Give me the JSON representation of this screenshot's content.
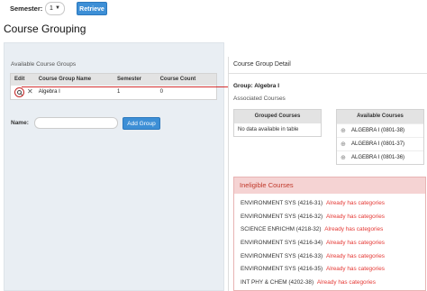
{
  "topbar": {
    "semester_label": "Semester:",
    "semester_value": "1",
    "retrieve_label": "Retrieve"
  },
  "page_title": "Course Grouping",
  "left": {
    "panel_title": "Available Course Groups",
    "columns": [
      "Edit",
      "Course Group Name",
      "Semester",
      "Course Count"
    ],
    "rows": [
      {
        "name": "Algebra I",
        "semester": "1",
        "count": "0"
      }
    ],
    "name_label": "Name:",
    "name_value": "",
    "add_group_label": "Add Group"
  },
  "detail": {
    "panel_title": "Course Group Detail",
    "group_label": "Group: Algebra I",
    "associated_label": "Associated Courses",
    "grouped_header": "Grouped Courses",
    "grouped_empty": "No data available in table",
    "available_header": "Available Courses",
    "available": [
      "ALGEBRA I (0801-38)",
      "ALGEBRA I (0801-37)",
      "ALGEBRA I (0801-36)"
    ],
    "ineligible_header": "Ineligible Courses",
    "ineligible_tag": "Already has categories",
    "ineligible": [
      "ENVIRONMENT SYS (4216-31)",
      "ENVIRONMENT SYS (4216-32)",
      "SCIENCE ENRICHM (4218-32)",
      "ENVIRONMENT SYS (4216-34)",
      "ENVIRONMENT SYS (4216-33)",
      "ENVIRONMENT SYS (4216-35)",
      "INT PHY & CHEM (4202-38)"
    ]
  },
  "colors": {
    "accent": "#3d8fd6",
    "highlight": "#d32f2f",
    "warning_bg": "#f5d3d3",
    "warning_text": "#e53935"
  },
  "icons": {
    "semester_dropdown": "chevron-down-icon",
    "edit": "magnifier-icon",
    "delete": "close-icon",
    "add_course": "plus-icon",
    "pointer": "arrow-right-icon"
  }
}
